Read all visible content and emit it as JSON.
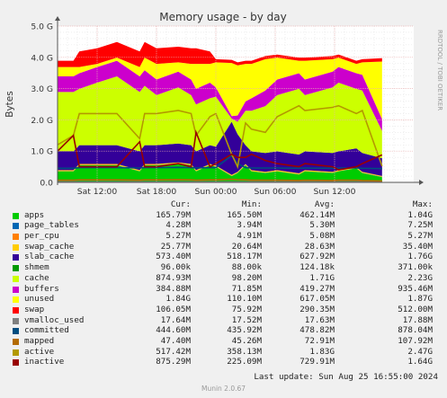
{
  "title": "Memory usage - by day",
  "ylabel": "Bytes",
  "watermark": "RRDTOOL / TOBI OETIKER",
  "legend_header": {
    "cur": "Cur:",
    "min": "Min:",
    "avg": "Avg:",
    "max": "Max:"
  },
  "last_update": "Last update: Sun Aug 25 16:55:00 2024",
  "version": "Munin 2.0.67",
  "colors": {
    "background": "#f0f0f0",
    "plot": "#ffffff",
    "grid_major": "#e8b0b0",
    "grid_minor": "#e3e3e3",
    "axis": "#555555"
  },
  "chart_data": {
    "type": "area",
    "title": "Memory usage - by day",
    "ylabel": "Bytes",
    "y_unit": "bytes",
    "ylim": [
      0,
      5.0
    ],
    "y_scale": "G",
    "y_ticks": [
      "0.0",
      "1.0 G",
      "2.0 G",
      "3.0 G",
      "4.0 G",
      "5.0 G"
    ],
    "y_tick_values": [
      0,
      1,
      2,
      3,
      4,
      5
    ],
    "x_range": [
      0,
      36
    ],
    "x_ticks": [
      "Sat 12:00",
      "Sat 18:00",
      "Sun 00:00",
      "Sun 06:00",
      "Sun 12:00"
    ],
    "x_tick_values": [
      4,
      10,
      16,
      22,
      28
    ],
    "x_sample_hours": [
      0,
      1.6,
      2.2,
      4,
      6,
      8.3,
      8.8,
      10,
      12.2,
      13.5,
      14,
      15.4,
      16,
      17.6,
      18.2,
      19,
      19.6,
      21,
      22.2,
      24.4,
      25,
      27.8,
      28.4,
      30.2,
      30.8,
      32.8
    ],
    "series": [
      {
        "name": "apps",
        "color": "#00cc00",
        "draw": "stack",
        "cur": "165.79M",
        "min": "165.50M",
        "avg": "462.14M",
        "max": "1.04G",
        "values": [
          0.35,
          0.35,
          0.55,
          0.55,
          0.55,
          0.35,
          0.55,
          0.55,
          0.6,
          0.55,
          0.35,
          0.55,
          0.5,
          0.2,
          0.3,
          0.55,
          0.35,
          0.3,
          0.35,
          0.25,
          0.35,
          0.3,
          0.35,
          0.45,
          0.3,
          0.17
        ]
      },
      {
        "name": "page_tables",
        "color": "#0066b3",
        "draw": "stack",
        "cur": "4.28M",
        "min": "3.94M",
        "avg": "5.30M",
        "max": "7.25M",
        "values": [
          0.005,
          0.005,
          0.005,
          0.005,
          0.005,
          0.005,
          0.005,
          0.005,
          0.005,
          0.005,
          0.005,
          0.005,
          0.005,
          0.005,
          0.005,
          0.005,
          0.005,
          0.005,
          0.005,
          0.005,
          0.005,
          0.005,
          0.005,
          0.005,
          0.005,
          0.004
        ]
      },
      {
        "name": "per_cpu",
        "color": "#ff8000",
        "draw": "stack",
        "cur": "5.27M",
        "min": "4.91M",
        "avg": "5.08M",
        "max": "5.27M",
        "values": [
          0.005,
          0.005,
          0.005,
          0.005,
          0.005,
          0.005,
          0.005,
          0.005,
          0.005,
          0.005,
          0.005,
          0.005,
          0.005,
          0.005,
          0.005,
          0.005,
          0.005,
          0.005,
          0.005,
          0.005,
          0.005,
          0.005,
          0.005,
          0.005,
          0.005,
          0.005
        ]
      },
      {
        "name": "swap_cache",
        "color": "#ffcc00",
        "draw": "stack",
        "cur": "25.77M",
        "min": "20.64M",
        "avg": "28.63M",
        "max": "35.40M",
        "values": [
          0.03,
          0.03,
          0.03,
          0.03,
          0.03,
          0.03,
          0.03,
          0.03,
          0.03,
          0.03,
          0.03,
          0.03,
          0.03,
          0.03,
          0.03,
          0.03,
          0.03,
          0.03,
          0.03,
          0.03,
          0.03,
          0.03,
          0.03,
          0.03,
          0.03,
          0.025
        ]
      },
      {
        "name": "slab_cache",
        "color": "#330099",
        "draw": "stack",
        "cur": "573.40M",
        "min": "518.17M",
        "avg": "627.92M",
        "max": "1.76G",
        "values": [
          0.6,
          0.6,
          0.6,
          0.6,
          0.6,
          0.6,
          0.6,
          0.6,
          0.6,
          0.6,
          0.6,
          0.6,
          0.6,
          1.7,
          1.2,
          0.6,
          0.6,
          0.6,
          0.6,
          0.6,
          0.6,
          0.6,
          0.6,
          0.6,
          0.6,
          0.57
        ]
      },
      {
        "name": "shmem",
        "color": "#009900",
        "draw": "stack",
        "cur": "96.00k",
        "min": "88.00k",
        "avg": "124.18k",
        "max": "371.00k",
        "values": [
          0.0001,
          0.0001,
          0.0001,
          0.0001,
          0.0001,
          0.0001,
          0.0001,
          0.0001,
          0.0001,
          0.0001,
          0.0001,
          0.0001,
          0.0001,
          0.0001,
          0.0001,
          0.0001,
          0.0001,
          0.0001,
          0.0001,
          0.0001,
          0.0001,
          0.0001,
          0.0001,
          0.0001,
          0.0001,
          0.0001
        ]
      },
      {
        "name": "cache",
        "color": "#ccff00",
        "draw": "stack",
        "cur": "874.93M",
        "min": "98.20M",
        "avg": "1.71G",
        "max": "2.23G",
        "values": [
          1.9,
          1.9,
          1.8,
          2.0,
          2.2,
          1.9,
          1.9,
          1.6,
          1.8,
          1.6,
          1.5,
          1.5,
          1.6,
          0.1,
          0.4,
          1.1,
          1.3,
          1.5,
          1.8,
          2.1,
          1.8,
          2.1,
          2.2,
          1.9,
          2.0,
          0.87
        ]
      },
      {
        "name": "buffers",
        "color": "#cc00cc",
        "draw": "stack",
        "cur": "384.88M",
        "min": "71.85M",
        "avg": "419.27M",
        "max": "935.46M",
        "values": [
          0.5,
          0.5,
          0.5,
          0.5,
          0.5,
          0.5,
          0.5,
          0.5,
          0.5,
          0.5,
          0.5,
          0.5,
          0.3,
          0.08,
          0.2,
          0.3,
          0.4,
          0.5,
          0.5,
          0.5,
          0.5,
          0.5,
          0.5,
          0.5,
          0.5,
          0.38
        ]
      },
      {
        "name": "unused",
        "color": "#ffff00",
        "draw": "stack",
        "cur": "1.84G",
        "min": "110.10M",
        "avg": "617.05M",
        "max": "1.87G",
        "values": [
          0.3,
          0.3,
          0.2,
          0.1,
          0.1,
          0.3,
          0.4,
          0.5,
          0.3,
          0.5,
          0.8,
          0.6,
          0.8,
          1.7,
          1.6,
          1.2,
          1.1,
          1.0,
          0.7,
          0.4,
          0.6,
          0.4,
          0.3,
          0.3,
          0.4,
          1.84
        ]
      },
      {
        "name": "swap",
        "color": "#ff0000",
        "draw": "stack",
        "cur": "106.05M",
        "min": "75.92M",
        "avg": "290.35M",
        "max": "512.00M",
        "values": [
          0.2,
          0.2,
          0.5,
          0.5,
          0.5,
          0.5,
          0.5,
          0.5,
          0.5,
          0.5,
          0.5,
          0.4,
          0.1,
          0.1,
          0.1,
          0.1,
          0.1,
          0.1,
          0.1,
          0.1,
          0.1,
          0.1,
          0.1,
          0.1,
          0.1,
          0.106
        ]
      },
      {
        "name": "vmalloc_used",
        "color": "#808080",
        "draw": "line",
        "cur": "17.64M",
        "min": "17.52M",
        "avg": "17.63M",
        "max": "17.88M",
        "values": [
          0.018,
          0.018,
          0.018,
          0.018,
          0.018,
          0.018,
          0.018,
          0.018,
          0.018,
          0.018,
          0.018,
          0.018,
          0.018,
          0.018,
          0.018,
          0.018,
          0.018,
          0.018,
          0.018,
          0.018,
          0.018,
          0.018,
          0.018,
          0.018,
          0.018,
          0.018
        ]
      },
      {
        "name": "committed",
        "color": "#004d80",
        "draw": "line",
        "cur": "444.60M",
        "min": "435.92M",
        "avg": "478.82M",
        "max": "878.04M",
        "values": [
          0.45,
          0.45,
          0.47,
          0.47,
          0.47,
          0.46,
          0.47,
          0.47,
          0.48,
          0.47,
          0.46,
          0.47,
          0.47,
          0.86,
          0.6,
          0.47,
          0.46,
          0.46,
          0.46,
          0.45,
          0.46,
          0.45,
          0.46,
          0.46,
          0.45,
          0.44
        ]
      },
      {
        "name": "mapped",
        "color": "#b36b00",
        "draw": "line",
        "cur": "47.40M",
        "min": "45.26M",
        "avg": "72.91M",
        "max": "107.92M",
        "values": [
          0.07,
          0.07,
          0.08,
          0.08,
          0.08,
          0.07,
          0.08,
          0.08,
          0.09,
          0.08,
          0.07,
          0.08,
          0.08,
          0.1,
          0.09,
          0.08,
          0.07,
          0.07,
          0.07,
          0.06,
          0.07,
          0.06,
          0.07,
          0.07,
          0.06,
          0.047
        ]
      },
      {
        "name": "active",
        "color": "#b39900",
        "draw": "line",
        "cur": "517.42M",
        "min": "358.13M",
        "avg": "1.83G",
        "max": "2.47G",
        "values": [
          1.2,
          1.5,
          2.2,
          2.2,
          2.2,
          1.4,
          2.2,
          2.2,
          2.3,
          2.2,
          1.5,
          2.1,
          2.2,
          0.9,
          0.5,
          1.9,
          1.7,
          1.6,
          2.1,
          2.45,
          2.3,
          2.4,
          2.45,
          2.2,
          2.3,
          0.52
        ]
      },
      {
        "name": "inactive",
        "color": "#990000",
        "draw": "line",
        "cur": "875.29M",
        "min": "225.09M",
        "avg": "729.91M",
        "max": "1.64G",
        "values": [
          1.0,
          1.5,
          0.5,
          0.5,
          0.5,
          1.3,
          0.5,
          0.5,
          0.6,
          0.5,
          1.6,
          0.5,
          0.6,
          0.9,
          0.8,
          0.8,
          0.9,
          0.7,
          0.6,
          0.5,
          0.6,
          0.5,
          0.4,
          0.5,
          0.6,
          0.88
        ]
      }
    ]
  }
}
